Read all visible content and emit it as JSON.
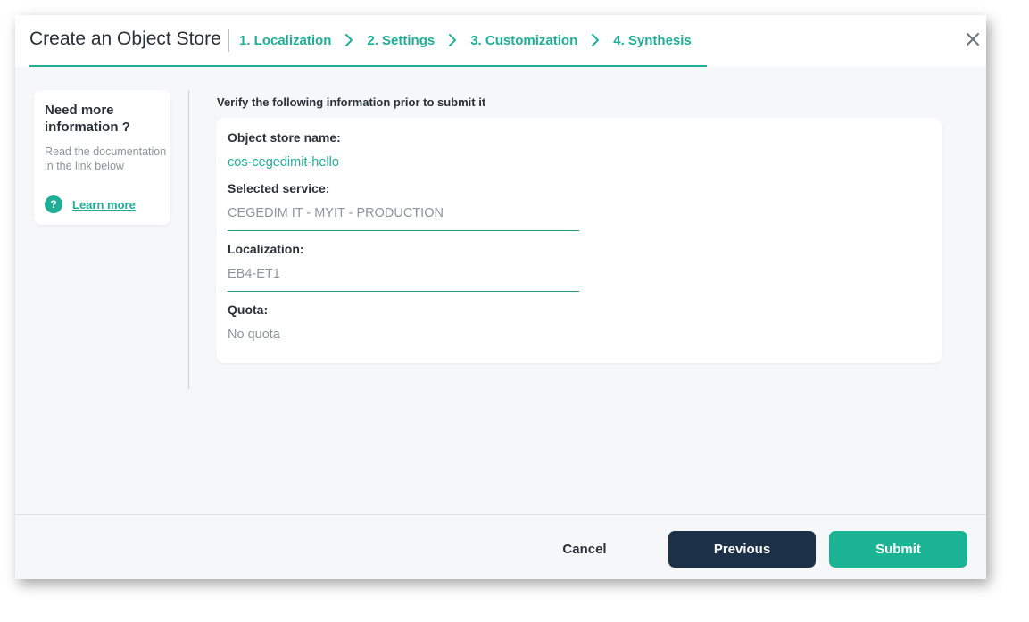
{
  "dialog": {
    "title": "Create an Object Store",
    "steps": [
      {
        "label": "1. Localization"
      },
      {
        "label": "2. Settings"
      },
      {
        "label": "3. Customization"
      },
      {
        "label": "4. Synthesis"
      }
    ],
    "active_step": 4
  },
  "help": {
    "title": "Need more information ?",
    "text": "Read the documentation in the link below",
    "icon_glyph": "?",
    "link_label": "Learn more"
  },
  "synthesis": {
    "intro": "Verify the following information prior to submit it",
    "fields": [
      {
        "label": "Object store name:",
        "value": "cos-cegedimit-hello"
      },
      {
        "label": "Selected service:",
        "value": "CEGEDIM IT - MYIT - PRODUCTION"
      },
      {
        "label": "Localization:",
        "value": "EB4-ET1"
      },
      {
        "label": "Quota:",
        "value": "No quota"
      }
    ]
  },
  "footer": {
    "cancel_label": "Cancel",
    "previous_label": "Previous",
    "submit_label": "Submit"
  },
  "colors": {
    "accent": "#1faf97",
    "primary_dark": "#1c3047",
    "submit": "#1ab394",
    "background": "#f6f7f9"
  },
  "icons": {
    "close": "close-icon",
    "step_separator": "chevron-right-icon",
    "help": "question-icon"
  }
}
